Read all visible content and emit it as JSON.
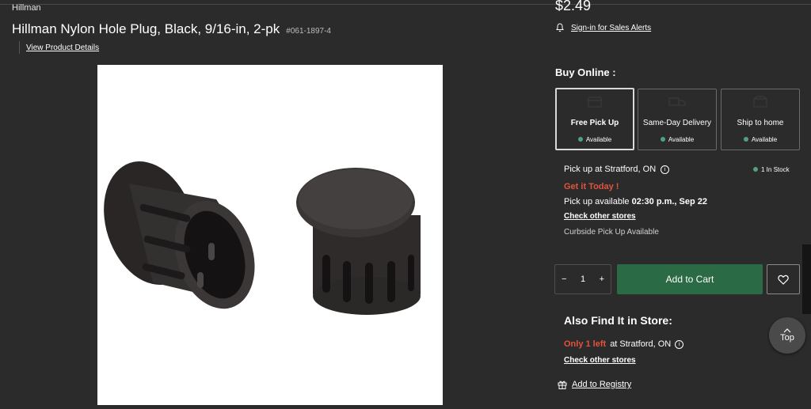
{
  "product": {
    "brand": "Hillman",
    "title": "Hillman Nylon Hole Plug, Black, 9/16-in, 2-pk",
    "sku": "#061-1897-4",
    "view_details": "View Product Details",
    "price": "$2.49",
    "alerts_link": "Sign-in for Sales Alerts"
  },
  "buy_online": {
    "heading": "Buy Online :",
    "options": [
      {
        "label": "Free Pick Up",
        "status": "Available",
        "icon": "store-icon"
      },
      {
        "label": "Same-Day Delivery",
        "status": "Available",
        "icon": "delivery-truck-icon"
      },
      {
        "label": "Ship to home",
        "status": "Available",
        "icon": "shipping-box-icon"
      }
    ]
  },
  "pickup": {
    "location": "Pick up at Stratford, ON",
    "stock": "1 In Stock",
    "get_it": "Get it Today !",
    "available_prefix": "Pick up available",
    "available_time": "02:30 p.m., Sep 22",
    "check_stores": "Check other stores",
    "curbside": "Curbside Pick Up Available"
  },
  "cart": {
    "minus": "−",
    "quantity": "1",
    "plus": "+",
    "add_to_cart": "Add to Cart"
  },
  "in_store": {
    "heading": "Also Find It in Store:",
    "only_left": "Only 1 left",
    "at_store": "at Stratford, ON",
    "check_stores": "Check other stores",
    "registry": "Add to Registry"
  },
  "top_button": "Top",
  "colors": {
    "background": "#2b2b2b",
    "accent_green": "#2a6b45",
    "alert_red": "#e2533e",
    "status_green": "#4fa27a"
  }
}
